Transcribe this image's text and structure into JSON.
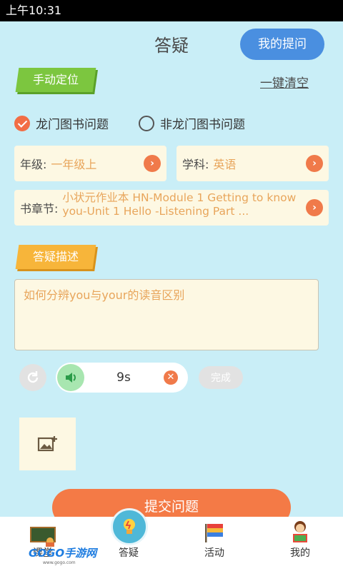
{
  "status_bar": {
    "time": "上午10:31"
  },
  "header": {
    "title": "答疑",
    "my_questions_label": "我的提问"
  },
  "locate": {
    "manual_label": "手动定位",
    "clear_label": "一键清空"
  },
  "book_type": {
    "options": [
      {
        "label": "龙门图书问题",
        "checked": true
      },
      {
        "label": "非龙门图书问题",
        "checked": false
      }
    ]
  },
  "fields": {
    "grade": {
      "label": "年级:",
      "value": "一年级上"
    },
    "subject": {
      "label": "学科:",
      "value": "英语"
    },
    "chapter": {
      "label": "书章节:",
      "value": "小状元作业本 HN-Module 1 Getting to know you-Unit 1 Hello  -Listening Part ..."
    }
  },
  "description": {
    "tag_label": "答疑描述",
    "text": "如何分辨you与your的读音区别"
  },
  "audio": {
    "duration": "9s",
    "done_label": "完成"
  },
  "submit_label": "提交问题",
  "tabs": [
    {
      "label": "课堂",
      "icon": "classroom-icon"
    },
    {
      "label": "答疑",
      "icon": "lightbulb-icon",
      "active": true
    },
    {
      "label": "活动",
      "icon": "flag-icon"
    },
    {
      "label": "我的",
      "icon": "reading-person-icon"
    }
  ],
  "watermark": {
    "text": "GOGO手游网",
    "sub": "www.gogo.com"
  },
  "colors": {
    "background": "#c9eef7",
    "accent_orange": "#f47a46",
    "accent_blue": "#4a8fe0",
    "accent_green": "#7cc63f"
  }
}
